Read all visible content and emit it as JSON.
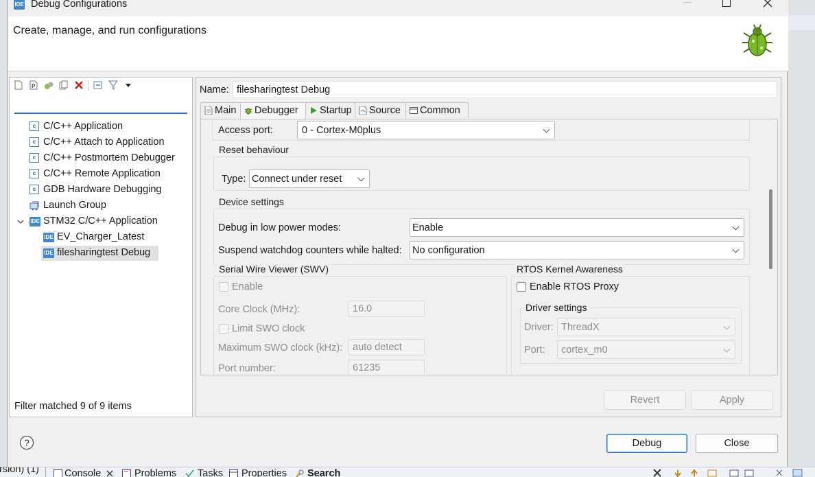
{
  "window": {
    "title": "Debug Configurations",
    "header_text": "Create, manage, and run configurations"
  },
  "left_pane": {
    "filter_placeholder": "",
    "tree": [
      {
        "label": "C/C++ Application",
        "icon": "c-launch-icon"
      },
      {
        "label": "C/C++ Attach to Application",
        "icon": "c-launch-icon"
      },
      {
        "label": "C/C++ Postmortem Debugger",
        "icon": "c-launch-icon"
      },
      {
        "label": "C/C++ Remote Application",
        "icon": "c-launch-icon"
      },
      {
        "label": "GDB Hardware Debugging",
        "icon": "c-launch-icon"
      },
      {
        "label": "Launch Group",
        "icon": "launch-group-icon"
      },
      {
        "label": "STM32 C/C++ Application",
        "icon": "ide-icon",
        "expanded": true
      },
      {
        "label": "EV_Charger_Latest",
        "icon": "ide-icon",
        "child": true
      },
      {
        "label": "filesharingtest Debug",
        "icon": "ide-icon",
        "child": true,
        "selected": true
      }
    ],
    "status": "Filter matched 9 of 9 items"
  },
  "config": {
    "name_label": "Name:",
    "name_value": "filesharingtest Debug",
    "tabs": [
      "Main",
      "Debugger",
      "Startup",
      "Source",
      "Common"
    ],
    "active_tab": "Debugger",
    "access_port_label": "Access port:",
    "access_port_value": "0 - Cortex-M0plus",
    "reset": {
      "group": "Reset behaviour",
      "type_label": "Type:",
      "type_value": "Connect under reset"
    },
    "device": {
      "group": "Device settings",
      "low_power_label": "Debug in low power modes:",
      "low_power_value": "Enable",
      "watchdog_label": "Suspend watchdog counters while halted:",
      "watchdog_value": "No configuration"
    },
    "swv": {
      "group": "Serial Wire Viewer (SWV)",
      "enable_label": "Enable",
      "core_clock_label": "Core Clock (MHz):",
      "core_clock_value": "16.0",
      "limit_label": "Limit SWO clock",
      "max_swo_label": "Maximum SWO clock (kHz):",
      "max_swo_value": "auto detect",
      "port_label": "Port number:",
      "port_value": "61235"
    },
    "rtos": {
      "group": "RTOS Kernel Awareness",
      "enable_label": "Enable RTOS Proxy",
      "driver_group": "Driver settings",
      "driver_label": "Driver:",
      "driver_value": "ThreadX",
      "port_label": "Port:",
      "port_value": "cortex_m0"
    },
    "scroll_fraction": 0.4
  },
  "buttons": {
    "revert": "Revert",
    "apply": "Apply",
    "debug": "Debug",
    "close": "Close"
  },
  "bottom_bar": {
    "left_fragment": "rsion) (1)",
    "tabs": [
      "Console",
      "Problems",
      "Tasks",
      "Properties",
      "Search"
    ]
  },
  "colors": {
    "accent": "#2a6fc0",
    "ide_badge": "#3f88d0",
    "selection": "#e1e1e1"
  }
}
